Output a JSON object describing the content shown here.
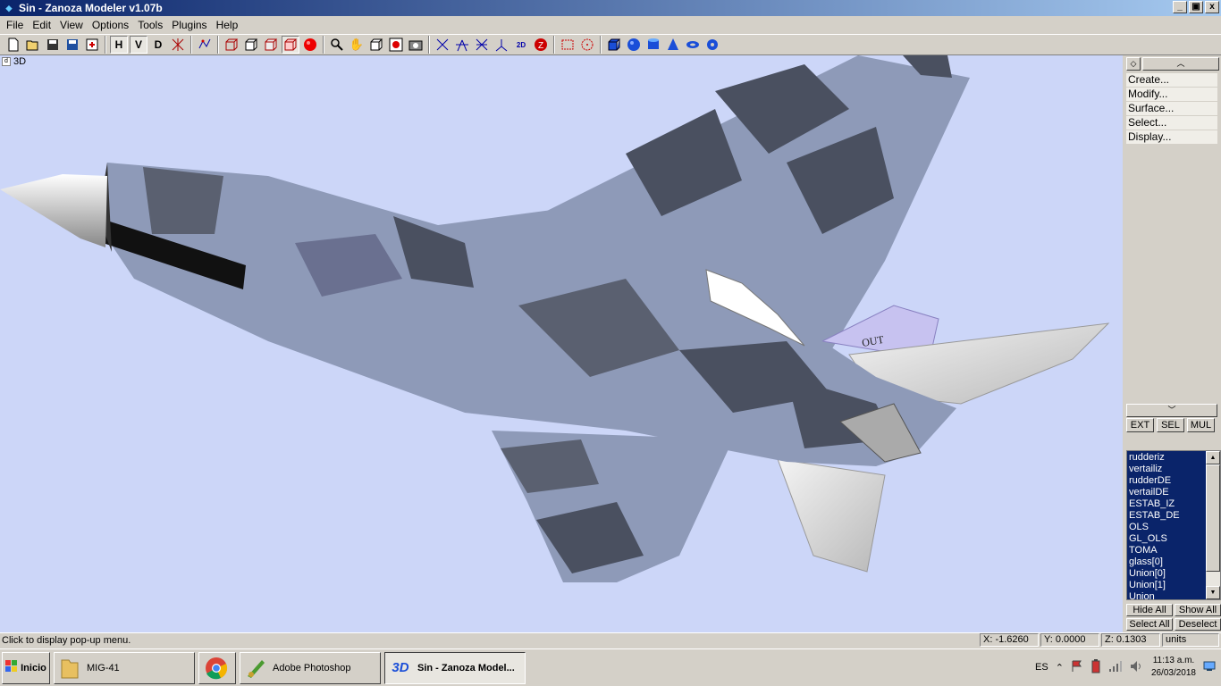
{
  "window": {
    "title": "Sin - Zanoza Modeler v1.07b",
    "controls": {
      "minimize": "_",
      "restore": "▣",
      "close": "x"
    }
  },
  "menu": [
    "File",
    "Edit",
    "View",
    "Options",
    "Tools",
    "Plugins",
    "Help"
  ],
  "toolbar": {
    "view_h": "H",
    "view_v": "V",
    "view_d": "D",
    "groups": [
      [
        "new-icon",
        "open-icon",
        "save-icon",
        "save-as-icon",
        "import-icon"
      ],
      [
        "wire-icon"
      ],
      [
        "cube-wire-icon",
        "cube-icon",
        "cube-shaded-icon",
        "cube-active-icon",
        "sphere-red-icon"
      ],
      [
        "zoom-icon",
        "pan-icon",
        "frame-icon",
        "render-icon",
        "camera-icon"
      ],
      [
        "vertex-icon",
        "edge-icon",
        "face-icon",
        "axis-icon",
        "grid-icon",
        "z-icon"
      ],
      [
        "select-rect-icon",
        "select-circle-icon"
      ],
      [
        "box-icon",
        "sphere-icon",
        "cylinder-icon",
        "cone-icon",
        "torus-icon",
        "knot-icon"
      ]
    ]
  },
  "viewport": {
    "label": "3D",
    "corner": "d"
  },
  "panel": {
    "commands": [
      "Create...",
      "Modify...",
      "Surface...",
      "Select...",
      "Display..."
    ],
    "modes": [
      "EXT",
      "SEL",
      "MUL"
    ],
    "objects": [
      "rudderiz",
      "vertailiz",
      "rudderDE",
      "vertailDE",
      "ESTAB_IZ",
      "ESTAB_DE",
      "OLS",
      "GL_OLS",
      "TOMA",
      "glass[0]",
      "Union[0]",
      "Union[1]",
      "Union"
    ],
    "list_buttons": [
      "Hide All",
      "Show All",
      "Select All",
      "Deselect"
    ]
  },
  "status": {
    "message": "Click to display pop-up menu.",
    "x": "X: -1.6260",
    "y": "Y: 0.0000",
    "z": "Z: 0.1303",
    "units": "units"
  },
  "taskbar": {
    "start": "Inicio",
    "tasks": [
      {
        "label": "MIG-41",
        "icon": "folder-icon"
      },
      {
        "label": "",
        "icon": "chrome-icon"
      },
      {
        "label": "Adobe Photoshop",
        "icon": "photoshop-icon"
      },
      {
        "label": "Sin - Zanoza Model...",
        "icon": "zanoza-3d-icon"
      }
    ],
    "lang": "ES",
    "time": "11:13 a.m.",
    "date": "26/03/2018"
  },
  "colors": {
    "viewport_bg": "#ccd6f8",
    "title_start": "#0a246a",
    "title_end": "#a6caf0",
    "list_bg": "#0a246a",
    "camo_light": "#8e9ab8",
    "camo_dark": "#4a5060"
  }
}
